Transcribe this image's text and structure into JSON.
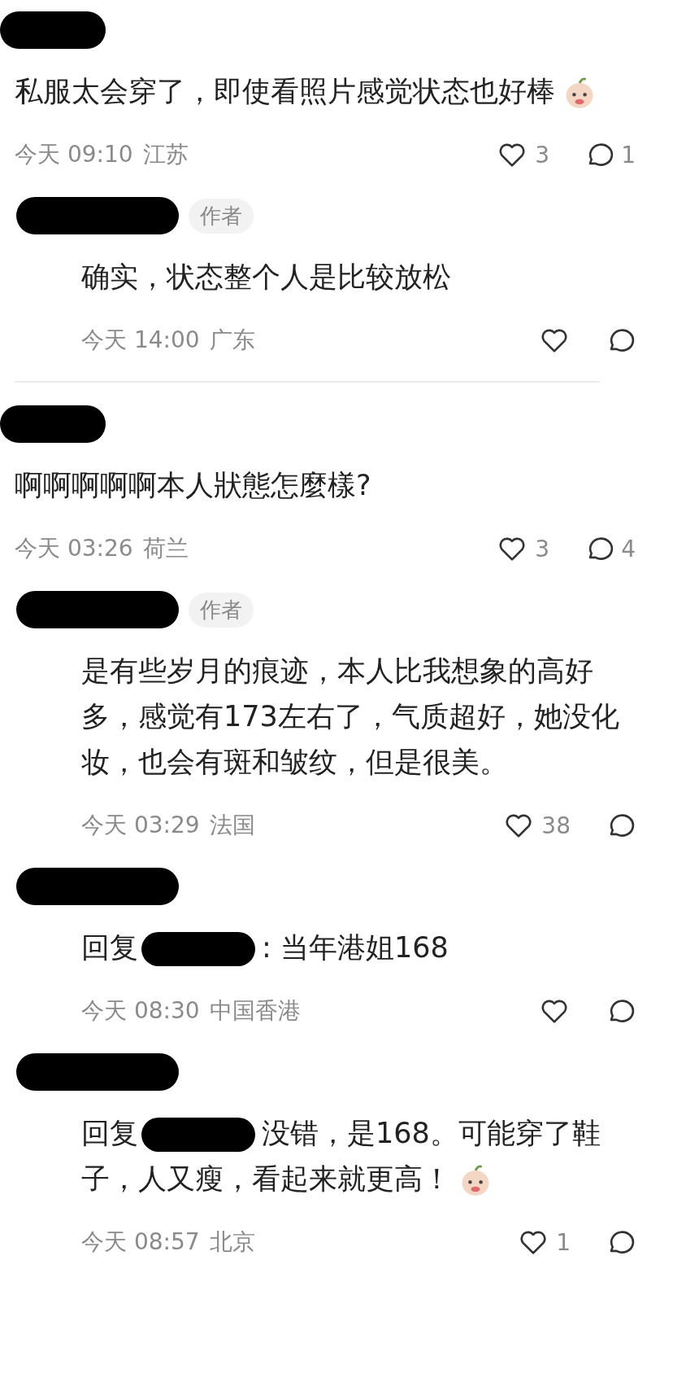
{
  "threads": [
    {
      "comments": [
        {
          "kind": "comment",
          "text": "私服太会穿了，即使看照片感觉状态也好棒",
          "emoji": true,
          "time": "今天 09:10",
          "location": "江苏",
          "likes": "3",
          "replies": "1"
        },
        {
          "kind": "reply",
          "author_tag": "作者",
          "text": "确实，状态整个人是比较放松",
          "time": "今天 14:00",
          "location": "广东"
        }
      ]
    },
    {
      "comments": [
        {
          "kind": "comment",
          "text": "啊啊啊啊啊本人狀態怎麼樣?",
          "time": "今天 03:26",
          "location": "荷兰",
          "likes": "3",
          "replies": "4"
        },
        {
          "kind": "reply",
          "author_tag": "作者",
          "text": "是有些岁月的痕迹，本人比我想象的高好多，感觉有173左右了，气质超好，她没化妆，也会有斑和皱纹，但是很美。",
          "time": "今天 03:29",
          "location": "法国",
          "likes": "38"
        },
        {
          "kind": "reply",
          "reply_prefix": "回复",
          "text": ": 当年港姐168",
          "time": "今天 08:30",
          "location": "中国香港"
        },
        {
          "kind": "reply",
          "reply_prefix": "回复",
          "text": "没错，是168。可能穿了鞋",
          "text_line_2": "子，人又瘦，看起来就更高！",
          "emoji": true,
          "time": "今天 08:57",
          "location": "北京",
          "likes": "1"
        }
      ]
    }
  ]
}
